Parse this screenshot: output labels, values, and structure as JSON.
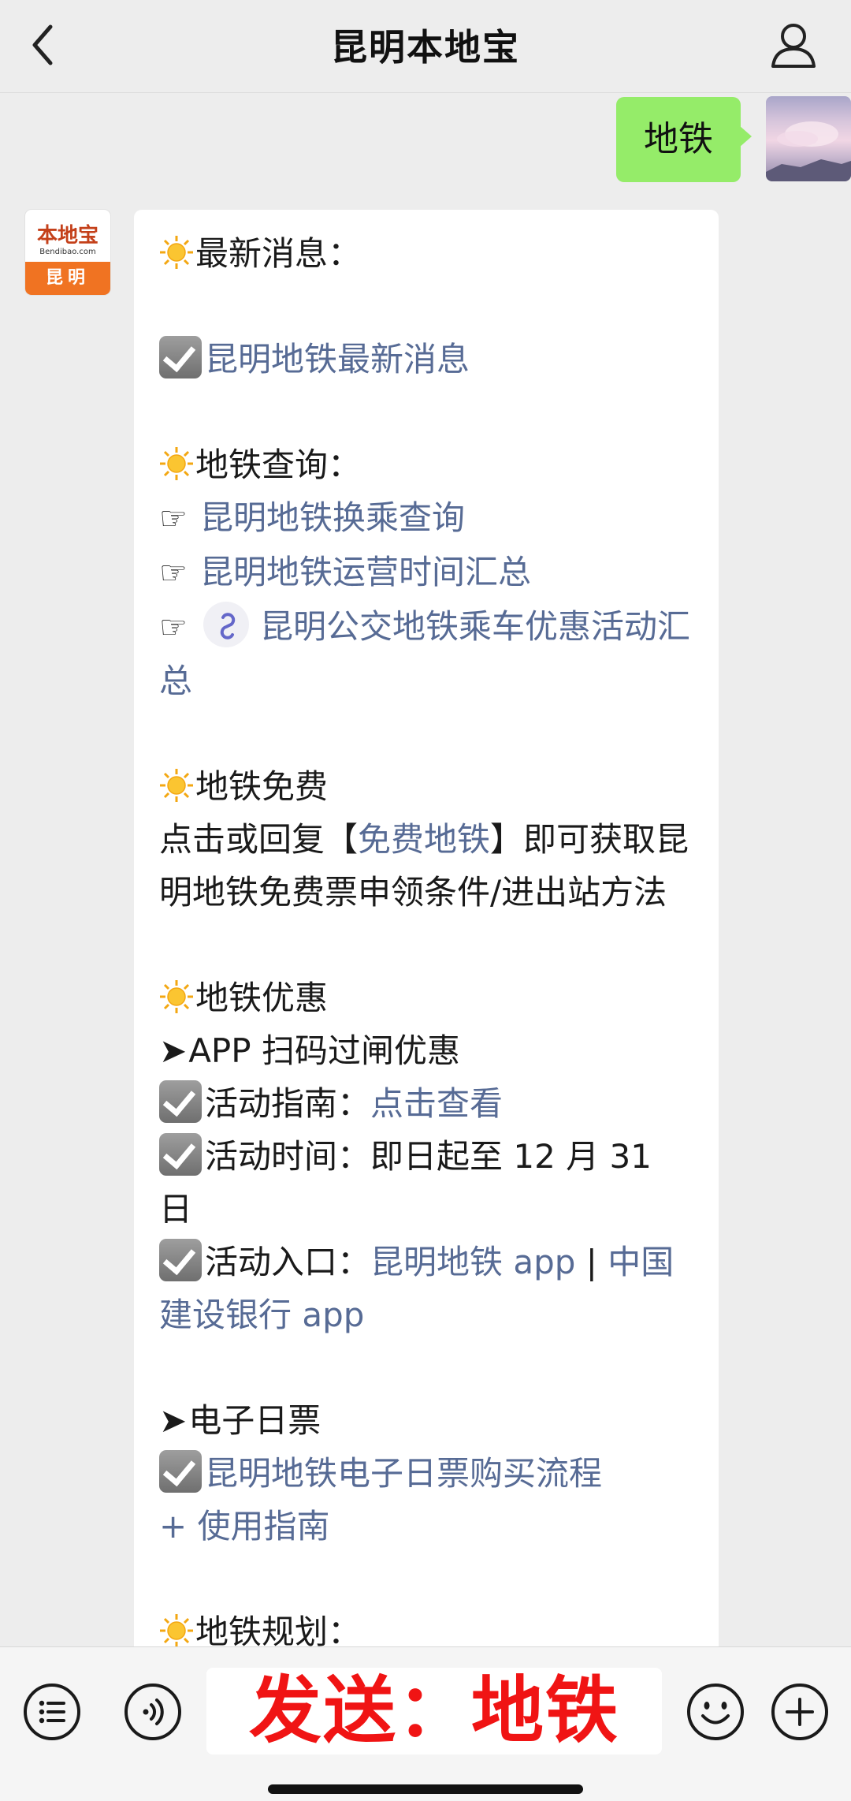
{
  "header": {
    "title": "昆明本地宝",
    "back_icon": "chevron-left-icon",
    "profile_icon": "user-icon"
  },
  "user_message": {
    "text": "地铁",
    "bubble_color": "#95ec69"
  },
  "bot": {
    "avatar": {
      "logo_text": "本地宝",
      "logo_url": "Bendibao.com",
      "logo_city": "昆明"
    },
    "sections": {
      "latest": {
        "heading": "最新消息：",
        "item": "昆明地铁最新消息"
      },
      "query": {
        "heading": "地铁查询：",
        "items": [
          "昆明地铁换乘查询",
          "昆明地铁运营时间汇总",
          "昆明公交地铁乘车优惠活动汇总"
        ]
      },
      "free": {
        "heading": "地铁免费",
        "text_before": "点击或回复【",
        "link": "免费地铁",
        "text_after": "】即可获取昆明地铁免费票申领条件/进出站方法"
      },
      "discount": {
        "heading": "地铁优惠",
        "subheading": "APP 扫码过闸优惠",
        "guide_label": "活动指南：",
        "guide_link": "点击查看",
        "time_label": "活动时间：",
        "time_value": "即日起至 12 月 31 日",
        "entry_label": "活动入口：",
        "entry_link1": "昆明地铁 app",
        "entry_separator": " | ",
        "entry_link2": "中国建设银行 app"
      },
      "day_ticket": {
        "heading": "电子日票",
        "link1": "昆明地铁电子日票购买流程",
        "link2": "+ 使用指南"
      },
      "plan": {
        "heading": "地铁规划："
      }
    },
    "link_color": "#576b95"
  },
  "bottom_bar": {
    "send_text": "发送：地铁",
    "send_text_color": "#f01414",
    "icons": [
      "menu-icon",
      "voice-icon",
      "emoji-icon",
      "plus-icon"
    ]
  }
}
